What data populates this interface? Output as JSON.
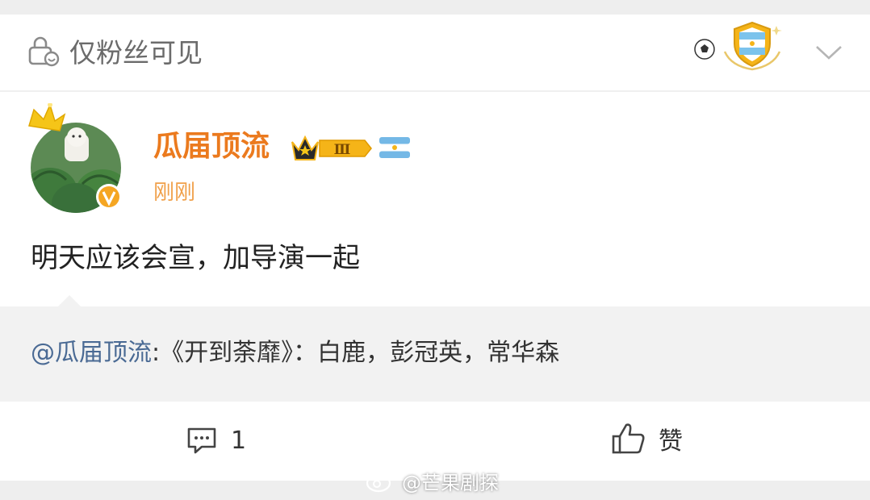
{
  "header": {
    "visibility_label": "仅粉丝可见",
    "icons": [
      "lock-person-icon",
      "soccer-ball-icon",
      "argentina-shield-badge-icon",
      "chevron-down-icon"
    ]
  },
  "post": {
    "author": {
      "name": "瓜届顶流",
      "level_badge": "Ⅲ",
      "avatar_icons": [
        "crown-icon",
        "verified-v-icon"
      ],
      "flag_icon": "argentina-flag-icon"
    },
    "timestamp": "刚刚",
    "text": "明天应该会宣，加导演一起"
  },
  "quote": {
    "mention": "@瓜届顶流",
    "text": ":《开到荼靡》：白鹿，彭冠英，常华森"
  },
  "actions": {
    "comment_count": "1",
    "like_label": "赞"
  },
  "watermark": {
    "text": "@芒果剧探"
  },
  "colors": {
    "username": "#eb7a1e",
    "timestamp": "#f0a04a",
    "mention": "#4a6a94",
    "badge_gold": "#f5b418"
  }
}
